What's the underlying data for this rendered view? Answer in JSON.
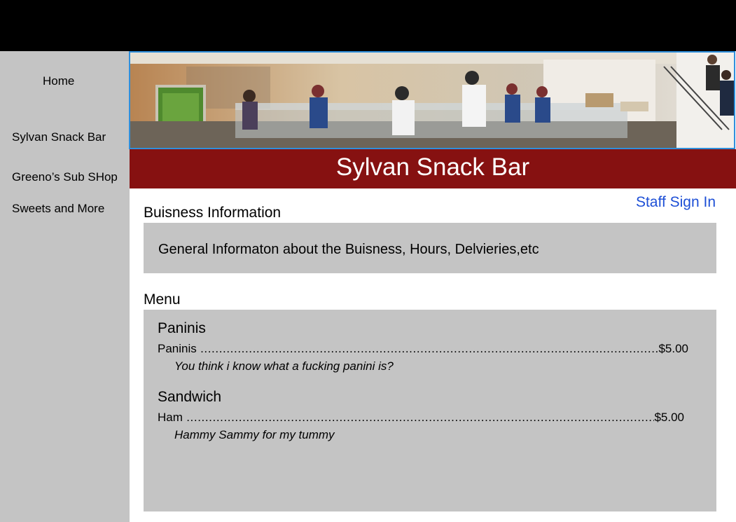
{
  "nav": {
    "items": [
      "Home",
      "Sylvan Snack Bar",
      "Greeno’s Sub SHop",
      "Sweets and More"
    ]
  },
  "header": {
    "title": "Sylvan Snack Bar",
    "staff_sign_in": "Staff Sign In"
  },
  "business": {
    "heading": "Buisness Information",
    "text": "General Informaton about the Buisness, Hours, Delvieries,etc"
  },
  "menu": {
    "heading": "Menu",
    "categories": [
      {
        "name": "Paninis",
        "item": "Paninis",
        "price": "$5.00",
        "description": "You think i know what a fucking panini is?"
      },
      {
        "name": "Sandwich",
        "item": "Ham",
        "price": "$5.00",
        "description": "Hammy Sammy for my tummy"
      }
    ]
  },
  "colors": {
    "title_bar": "#861111",
    "sidebar": "#c4c4c4",
    "link": "#1d4fd6",
    "hero_border": "#2f8fdc"
  }
}
